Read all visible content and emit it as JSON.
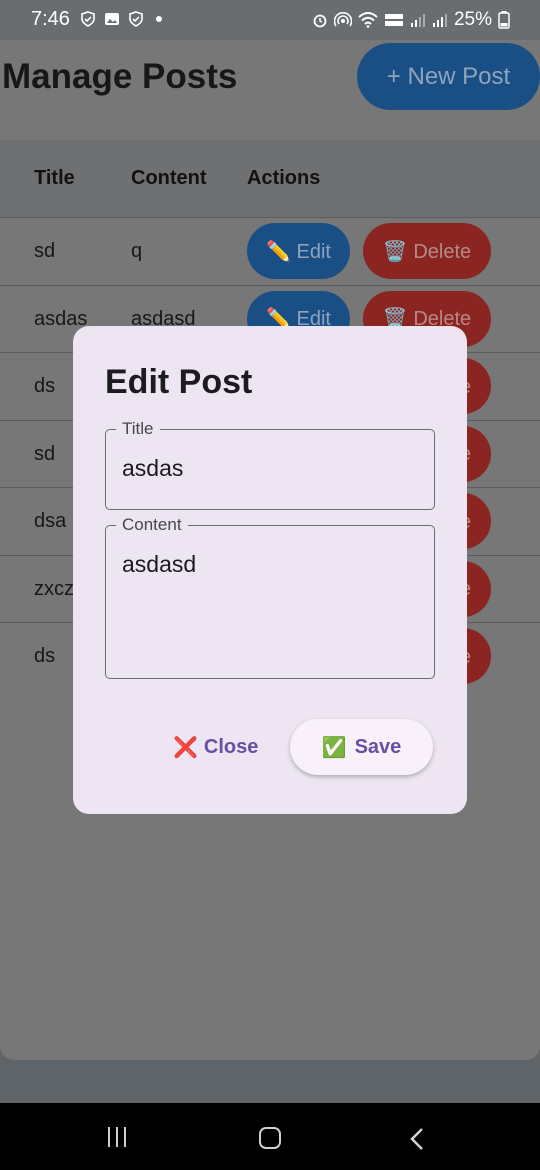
{
  "status_bar": {
    "time": "7:46",
    "battery": "25%",
    "icons": [
      "shield-icon",
      "image-icon",
      "shield-icon",
      "dot-icon",
      "alarm-icon",
      "hotspot-icon",
      "wifi-icon",
      "volte-icon",
      "signal-icon",
      "signal-icon",
      "battery-icon"
    ]
  },
  "header": {
    "title": "Manage Posts",
    "new_post_label": "+ New Post"
  },
  "table": {
    "columns": [
      "Title",
      "Content",
      "Actions"
    ],
    "edit_label": "✏️ Edit",
    "delete_label": "🗑️ Delete",
    "rows": [
      {
        "title": "sd",
        "content": "q"
      },
      {
        "title": "asdas",
        "content": "asdasd"
      },
      {
        "title": "ds",
        "content": ""
      },
      {
        "title": "sd",
        "content": ""
      },
      {
        "title": "dsa",
        "content": ""
      },
      {
        "title": "zxcz",
        "content": ""
      },
      {
        "title": "ds",
        "content": ""
      }
    ]
  },
  "dialog": {
    "title": "Edit Post",
    "title_field": {
      "label": "Title",
      "value": "asdas"
    },
    "content_field": {
      "label": "Content",
      "value": "asdasd"
    },
    "close_label": "Close",
    "close_icon": "❌",
    "save_label": "Save",
    "save_icon": "✅"
  },
  "colors": {
    "primary_button": "#1a4f86",
    "delete_button": "#8a2522",
    "dialog_bg": "#ede5f1",
    "accent_text": "#6750a4"
  }
}
